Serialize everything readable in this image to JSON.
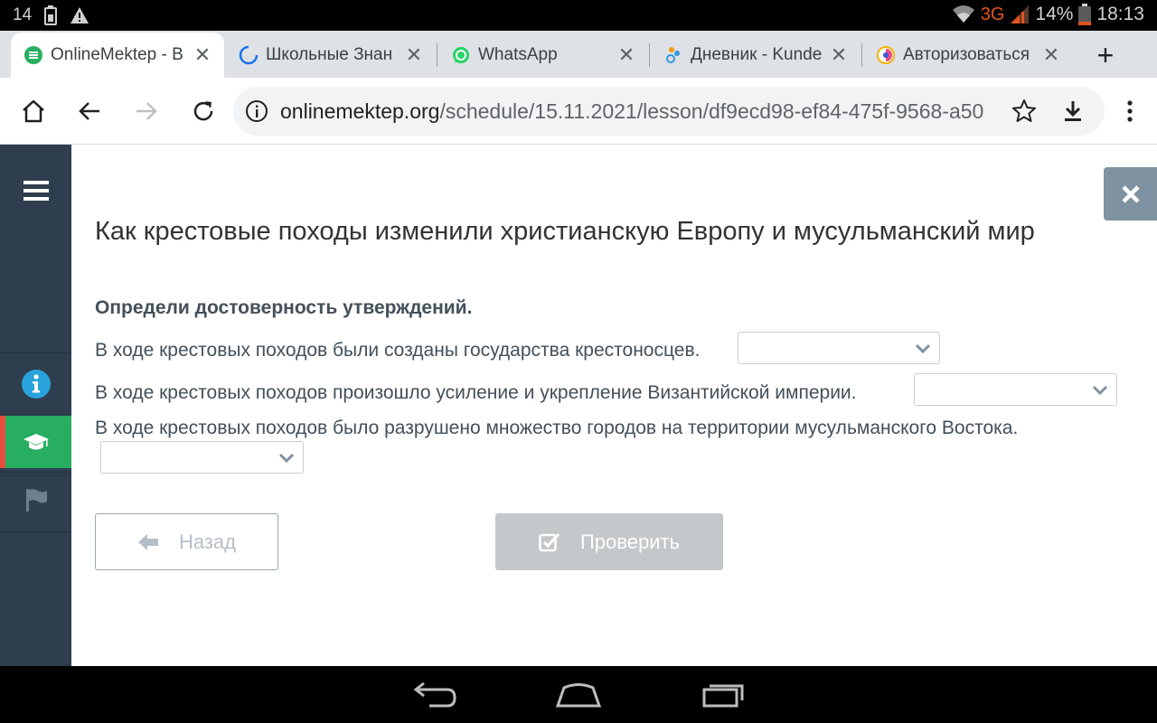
{
  "status_bar": {
    "notification_count": "14",
    "network": "3G",
    "battery": "14%",
    "time": "18:13"
  },
  "tabs": [
    {
      "title": "OnlineMektep - B",
      "close": "✕"
    },
    {
      "title": "Школьные Знан",
      "close": "✕"
    },
    {
      "title": "WhatsApp",
      "close": "✕"
    },
    {
      "title": "Дневник - Kunde",
      "close": "✕"
    },
    {
      "title": "Авторизоваться",
      "close": "✕"
    }
  ],
  "new_tab": "+",
  "address_bar": {
    "host": "onlinemektep.org",
    "path": "/schedule/15.11.2021/lesson/df9ecd98-ef84-475f-9568-a50"
  },
  "lesson": {
    "title": "Как крестовые походы изменили христианскую Европу и мусульманский мир",
    "instruction": "Определи достоверность утверждений.",
    "statements": [
      {
        "text": "В ходе крестовых походов были созданы государства крестоносцев.",
        "selected": ""
      },
      {
        "text": "В ходе крестовых походов произошло усиление и укрепление Византийской империи.",
        "selected": ""
      },
      {
        "text": "В ходе крестовых походов было разрушено множество городов на территории мусульманского Востока.",
        "selected": ""
      }
    ],
    "back_label": "Назад",
    "check_label": "Проверить"
  },
  "colors": {
    "sidebar": "#2e3e4e",
    "active_item": "#27ae60",
    "active_marker": "#e74c3c",
    "info_icon": "#29a3db",
    "close_button": "#7f92a2",
    "check_button": "#c4c8cb"
  },
  "icons": {
    "sidebar": [
      "menu-icon",
      "info-icon",
      "graduation-cap-icon",
      "flag-icon"
    ]
  }
}
